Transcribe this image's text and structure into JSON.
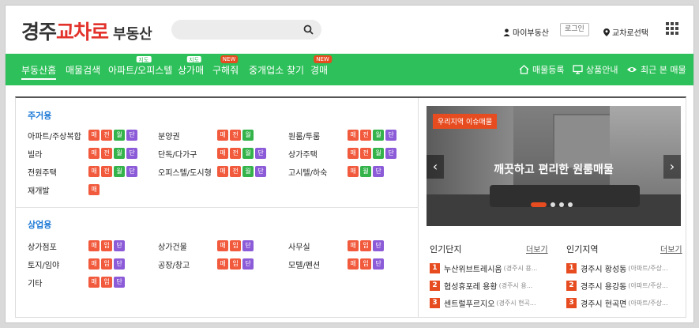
{
  "header": {
    "logo": {
      "part1": "경주",
      "part2": "교차로",
      "part3": "부동산"
    },
    "search": {
      "placeholder": "",
      "icon": "search-icon"
    },
    "my_realty": "마이부동산",
    "login": "로그인",
    "region_select": "교차로선택",
    "menu_icon": "grid-menu-icon"
  },
  "nav": {
    "items": [
      {
        "label": "부동산홈"
      },
      {
        "label": "매물검색"
      },
      {
        "label": "아파트/오피스텔",
        "badge": "지도"
      },
      {
        "label": "상가매",
        "badge": "지도"
      },
      {
        "label": "구해줘",
        "badge": "NEW"
      },
      {
        "label": "중개업소 찾기"
      },
      {
        "label": "경매",
        "badge": "NEW"
      }
    ],
    "right": [
      {
        "label": "매물등록",
        "icon": "house-icon"
      },
      {
        "label": "상품안내",
        "icon": "monitor-icon"
      },
      {
        "label": "최근 본 매물",
        "icon": "eye-icon"
      }
    ]
  },
  "residential": {
    "title": "주거용",
    "items": [
      {
        "name": "아파트/주상복합",
        "tags": [
          "매",
          "전",
          "월",
          "단"
        ]
      },
      {
        "name": "분양권",
        "tags": [
          "매",
          "전",
          "월"
        ]
      },
      {
        "name": "원룸/투룸",
        "tags": [
          "매",
          "전",
          "월",
          "단"
        ]
      },
      {
        "name": "빌라",
        "tags": [
          "매",
          "전",
          "월",
          "단"
        ]
      },
      {
        "name": "단독/다가구",
        "tags": [
          "매",
          "전",
          "월",
          "단"
        ]
      },
      {
        "name": "상가주택",
        "tags": [
          "매",
          "전",
          "월",
          "단"
        ]
      },
      {
        "name": "전원주택",
        "tags": [
          "매",
          "전",
          "월",
          "단"
        ]
      },
      {
        "name": "오피스텔/도시형",
        "tags": [
          "매",
          "전",
          "월",
          "단"
        ]
      },
      {
        "name": "고시텔/하숙",
        "tags": [
          "매",
          "월",
          "단"
        ]
      },
      {
        "name": "재개발",
        "tags": [
          "매"
        ]
      }
    ]
  },
  "commercial": {
    "title": "상업용",
    "items": [
      {
        "name": "상가점포",
        "tags": [
          "매",
          "임",
          "단"
        ]
      },
      {
        "name": "상가건물",
        "tags": [
          "매",
          "임",
          "단"
        ]
      },
      {
        "name": "사무실",
        "tags": [
          "매",
          "임",
          "단"
        ]
      },
      {
        "name": "토지/임야",
        "tags": [
          "매",
          "임",
          "단"
        ]
      },
      {
        "name": "공장/창고",
        "tags": [
          "매",
          "임",
          "단"
        ]
      },
      {
        "name": "모텔/펜션",
        "tags": [
          "매",
          "임",
          "단"
        ]
      },
      {
        "name": "기타",
        "tags": [
          "매",
          "임",
          "단"
        ]
      }
    ]
  },
  "tag_colors": {
    "매": "#f15a3d",
    "전": "#f15a3d",
    "월": "#33b34a",
    "단": "#8c5bd8",
    "임": "#f15a3d"
  },
  "banner": {
    "tag": "우리지역 이슈매물",
    "caption": "깨끗하고 편리한 원룸매물",
    "prev": "‹",
    "next": "›"
  },
  "popular_complex": {
    "title": "인기단지",
    "more": "더보기",
    "items": [
      {
        "rank": "1",
        "name": "누산위브트레시움",
        "sub": "(경주시 용..."
      },
      {
        "rank": "2",
        "name": "협성휴포레 용황",
        "sub": "(경주시 용..."
      },
      {
        "rank": "3",
        "name": "센트럴푸르지오",
        "sub": "(경주시 현곡..."
      }
    ]
  },
  "popular_region": {
    "title": "인기지역",
    "more": "더보기",
    "items": [
      {
        "rank": "1",
        "name": "경주시 황성동",
        "sub": "(아파트/주상..."
      },
      {
        "rank": "2",
        "name": "경주시 용강동",
        "sub": "(아파트/주상..."
      },
      {
        "rank": "3",
        "name": "경주시 현곡면",
        "sub": "(아파트/주상..."
      }
    ]
  }
}
